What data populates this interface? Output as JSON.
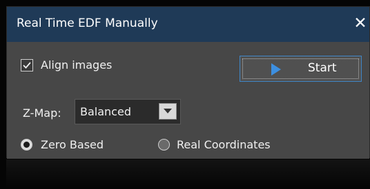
{
  "window": {
    "title": "Real Time EDF Manually"
  },
  "options": {
    "align_images_label": "Align images",
    "align_images_checked": true
  },
  "start_button": {
    "label": "Start"
  },
  "zmap": {
    "label": "Z-Map:",
    "selected": "Balanced"
  },
  "coordinates": {
    "zero_based_label": "Zero Based",
    "real_coordinates_label": "Real Coordinates",
    "selected": "Zero Based"
  },
  "icons": {
    "close": "close-icon",
    "check": "check-icon",
    "play": "play-icon",
    "dropdown": "chevron-down-icon"
  },
  "colors": {
    "titlebar": "#1f3a57",
    "dialog_bg": "#474747",
    "accent": "#3f86c8",
    "play": "#3d8fe0"
  }
}
